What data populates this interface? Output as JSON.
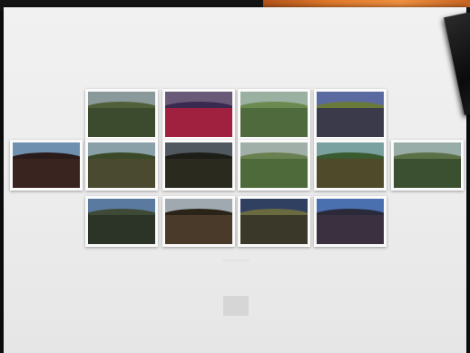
{
  "app": {
    "accent": "#e07a2c",
    "background": "#0e0e0e"
  },
  "gallery": {
    "rows": [
      [
        {
          "sky": "#8a9a9a",
          "land": "#3c4a2e",
          "ridge": "#51603b"
        },
        {
          "sky": "#6a5a78",
          "land": "#a02040",
          "ridge": "#3a2a50"
        },
        {
          "sky": "#9ab0a0",
          "land": "#4f6a3c",
          "ridge": "#6a8a52"
        },
        {
          "sky": "#5a6aa0",
          "land": "#3a3a4a",
          "ridge": "#6a7a3a"
        }
      ],
      [
        {
          "sky": "#7090b0",
          "land": "#3a2420",
          "ridge": "#2a1c1a"
        },
        {
          "sky": "#8aa0a8",
          "land": "#4a4a30",
          "ridge": "#3a4a28"
        },
        {
          "sky": "#505860",
          "land": "#2a2a1e",
          "ridge": "#1e1e18"
        },
        {
          "sky": "#a0b0a8",
          "land": "#4e6a3a",
          "ridge": "#6a8050"
        },
        {
          "sky": "#7aa0a0",
          "land": "#4e4a2a",
          "ridge": "#3a5a30"
        },
        {
          "sky": "#98aca8",
          "land": "#3a5030",
          "ridge": "#5a7046"
        }
      ],
      [
        {
          "sky": "#5a7aa0",
          "land": "#2c3428",
          "ridge": "#3e4a36"
        },
        {
          "sky": "#a0a8b0",
          "land": "#4a3a2a",
          "ridge": "#2a2418"
        },
        {
          "sky": "#304060",
          "land": "#3a3828",
          "ridge": "#6a6a40"
        },
        {
          "sky": "#4a70b0",
          "land": "#3a3040",
          "ridge": "#2a2a3a"
        }
      ]
    ]
  }
}
